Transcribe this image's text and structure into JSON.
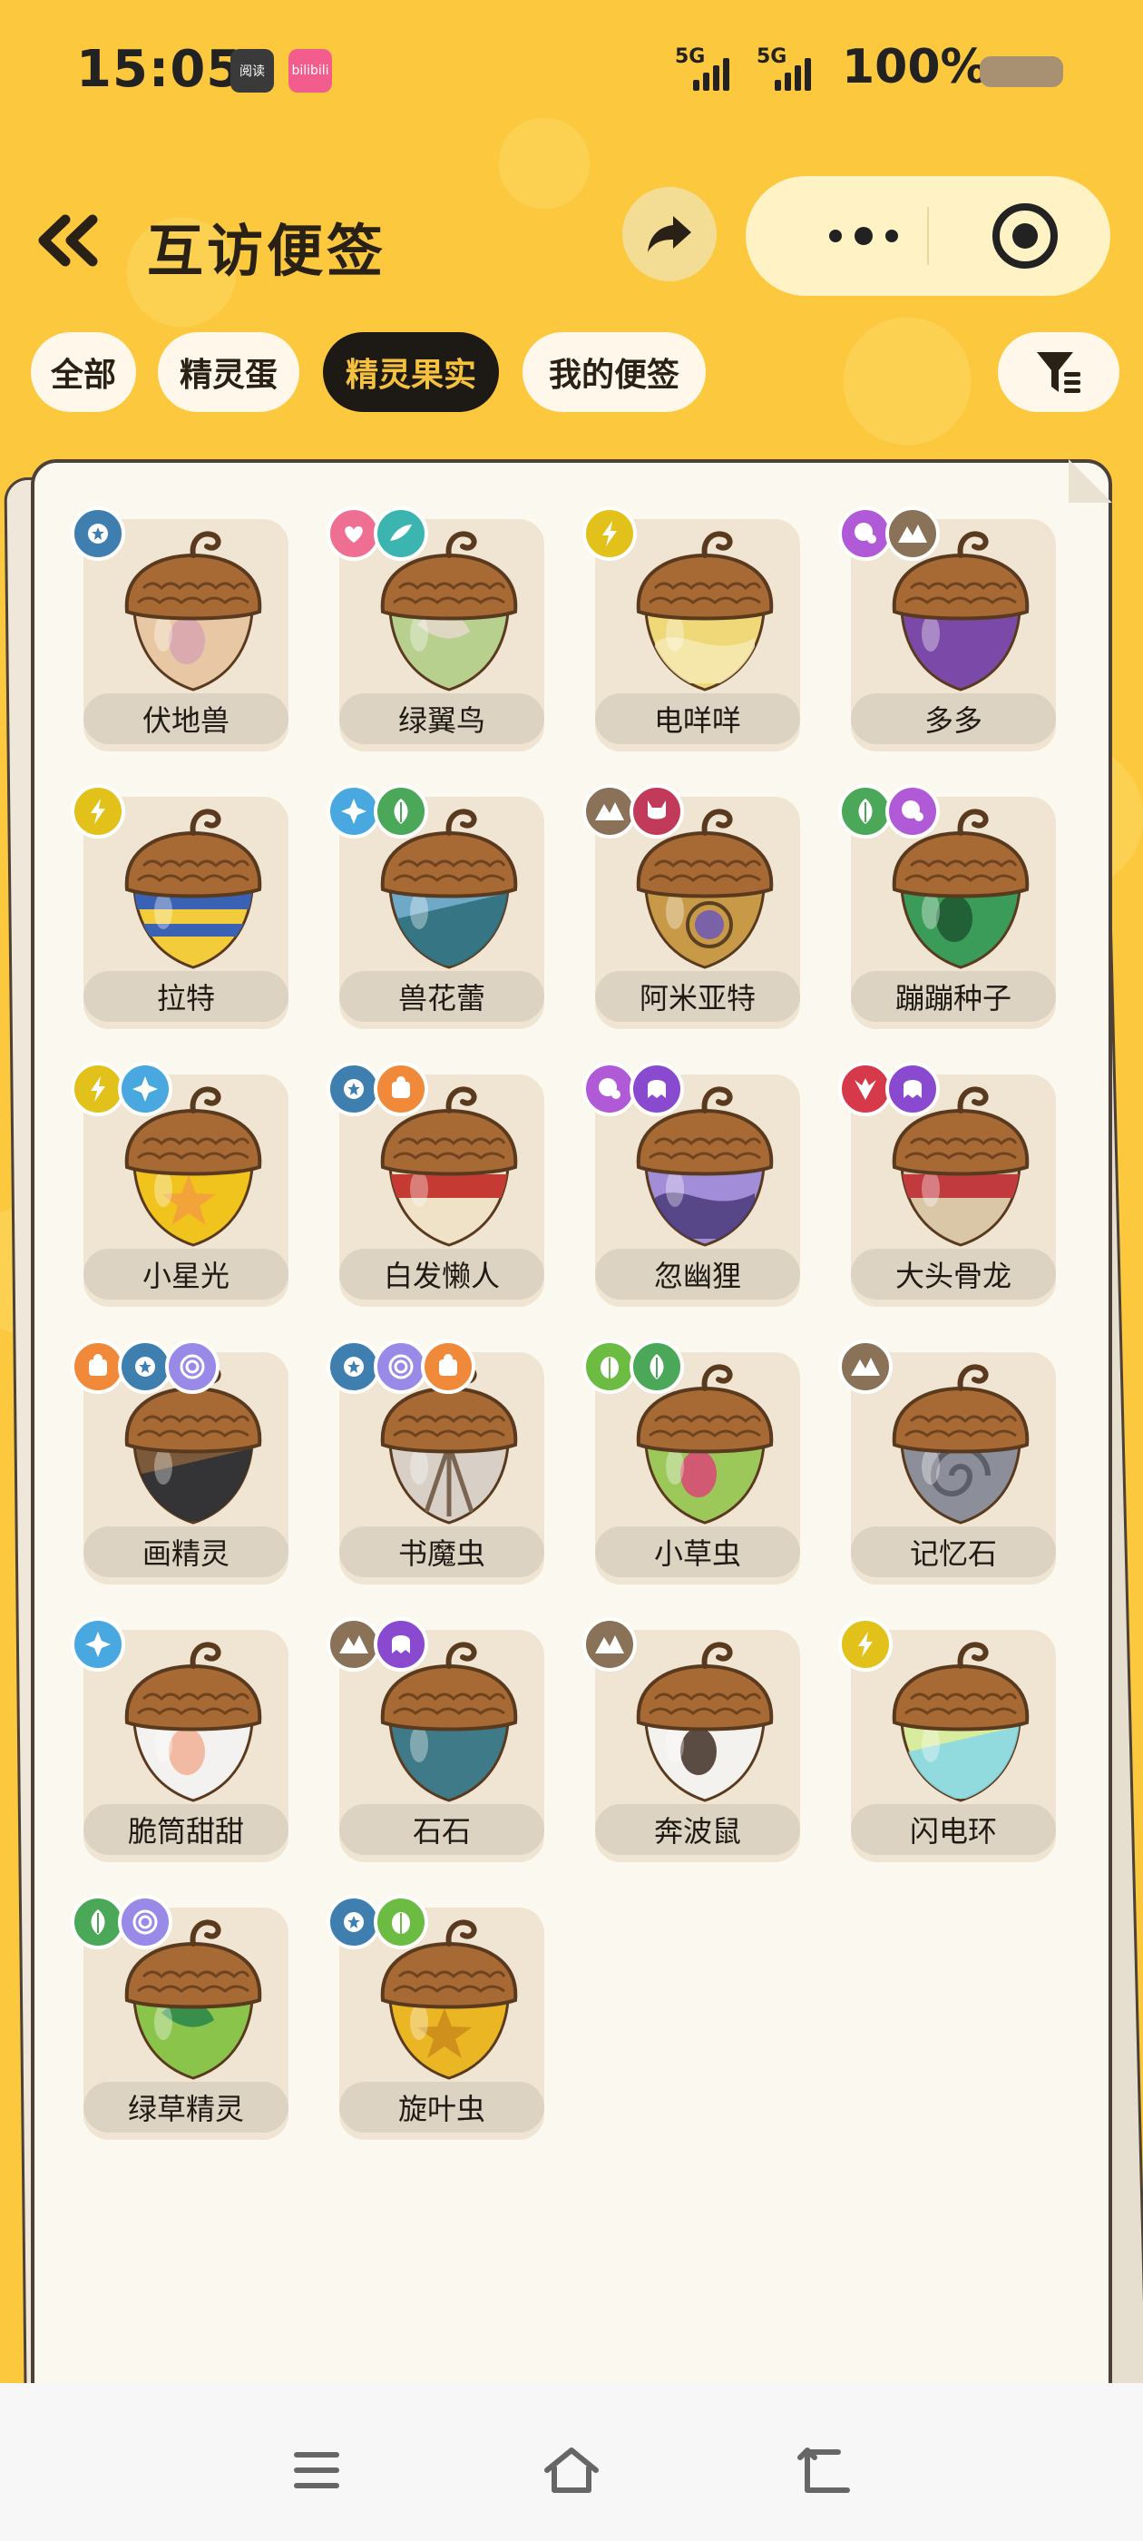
{
  "status_bar": {
    "time": "15:05",
    "apps": [
      {
        "name": "reader-app",
        "text": "阅读"
      },
      {
        "name": "bilibili-app",
        "text": "bilibili"
      }
    ],
    "signal_1": "5G",
    "signal_2": "5G",
    "battery": "100%"
  },
  "header": {
    "title": "互访便签",
    "icons": [
      "double-chevron-left-icon",
      "share-arrow-icon",
      "more-dots-icon",
      "target-icon"
    ]
  },
  "tabs": [
    {
      "label": "全部",
      "active": false
    },
    {
      "label": "精灵蛋",
      "active": false
    },
    {
      "label": "精灵果实",
      "active": true
    },
    {
      "label": "我的便签",
      "active": false
    }
  ],
  "filter_icon": "filter-icon",
  "colors": {
    "background": "#fbc83e",
    "active_tab_bg": "#1d1a16",
    "active_tab_text": "#f6c23d",
    "card_bg": "#fbf8ef"
  },
  "items": [
    {
      "name": "伏地兽",
      "types": [
        "normal"
      ],
      "body": "#e8c8a4",
      "accent": "#d9a6b0",
      "pattern": "spot"
    },
    {
      "name": "绿翼鸟",
      "types": [
        "cute",
        "wing"
      ],
      "body": "#b7d08e",
      "accent": "#e2d8c8",
      "pattern": "leaf"
    },
    {
      "name": "电咩咩",
      "types": [
        "electric"
      ],
      "body": "#eed878",
      "accent": "#f6e9b2",
      "pattern": "wave"
    },
    {
      "name": "多多",
      "types": [
        "ghost",
        "ground"
      ],
      "body": "#7b4aa8",
      "accent": "#5b3488",
      "pattern": "plain"
    },
    {
      "name": "拉特",
      "types": [
        "electric"
      ],
      "body": "#f2cc3a",
      "accent": "#3a62b4",
      "pattern": "stripes"
    },
    {
      "name": "兽花蕾",
      "types": [
        "ice",
        "grass"
      ],
      "body": "#6eaac8",
      "accent": "#2f6f7c",
      "pattern": "split"
    },
    {
      "name": "阿米亚特",
      "types": [
        "ground",
        "demon"
      ],
      "body": "#c89a48",
      "accent": "#7a62a8",
      "pattern": "gem"
    },
    {
      "name": "蹦蹦种子",
      "types": [
        "grass",
        "ghost"
      ],
      "body": "#3b9b58",
      "accent": "#1f5b32",
      "pattern": "spot"
    },
    {
      "name": "小星光",
      "types": [
        "electric",
        "ice"
      ],
      "body": "#f0c41c",
      "accent": "#f2a43a",
      "pattern": "star"
    },
    {
      "name": "白发懒人",
      "types": [
        "normal",
        "fire"
      ],
      "body": "#efe2c6",
      "accent": "#c63a34",
      "pattern": "band"
    },
    {
      "name": "忽幽狸",
      "types": [
        "ghost",
        "spirit"
      ],
      "body": "#a28ed8",
      "accent": "#4a3a7a",
      "pattern": "wave"
    },
    {
      "name": "大头骨龙",
      "types": [
        "dragon",
        "spirit"
      ],
      "body": "#d9c7a8",
      "accent": "#c03a3e",
      "pattern": "band"
    },
    {
      "name": "画精灵",
      "types": [
        "fire",
        "normal",
        "psychic"
      ],
      "body": "#7a5a3a",
      "accent": "#2c3036",
      "pattern": "split"
    },
    {
      "name": "书魔虫",
      "types": [
        "normal",
        "psychic",
        "fire"
      ],
      "body": "#d8d0c6",
      "accent": "#7a6452",
      "pattern": "shell"
    },
    {
      "name": "小草虫",
      "types": [
        "bug",
        "grass"
      ],
      "body": "#9cc85a",
      "accent": "#d84c74",
      "pattern": "spot"
    },
    {
      "name": "记忆石",
      "types": [
        "ground"
      ],
      "body": "#8c8e9a",
      "accent": "#5c5e6a",
      "pattern": "swirl"
    },
    {
      "name": "脆筒甜甜",
      "types": [
        "ice"
      ],
      "body": "#f4f2f0",
      "accent": "#f2b49a",
      "pattern": "spot"
    },
    {
      "name": "石石",
      "types": [
        "ground",
        "spirit"
      ],
      "body": "#3e7a88",
      "accent": "#8cd2d2",
      "pattern": "plain"
    },
    {
      "name": "奔波鼠",
      "types": [
        "ground"
      ],
      "body": "#f4f2ee",
      "accent": "#4a3a30",
      "pattern": "spot"
    },
    {
      "name": "闪电环",
      "types": [
        "electric"
      ],
      "body": "#d8ec9e",
      "accent": "#8ad8e4",
      "pattern": "split"
    },
    {
      "name": "绿草精灵",
      "types": [
        "grass",
        "psychic"
      ],
      "body": "#8ac44a",
      "accent": "#2f8a4a",
      "pattern": "leaf"
    },
    {
      "name": "旋叶虫",
      "types": [
        "normal",
        "bug"
      ],
      "body": "#eab624",
      "accent": "#d0901c",
      "pattern": "star"
    }
  ],
  "type_colors": {
    "normal": "#3e7fb0",
    "cute": "#ee6f92",
    "wing": "#3cb5b0",
    "electric": "#e2c21a",
    "ghost": "#b05ad8",
    "ground": "#8a7258",
    "ice": "#4aa8e0",
    "grass": "#4aa858",
    "demon": "#c23a5a",
    "fire": "#f08a3a",
    "spirit": "#8a4ad0",
    "dragon": "#d63a4a",
    "psychic": "#9a8ae8",
    "bug": "#6cbc44"
  },
  "bottom_nav": [
    "menu-icon",
    "home-icon",
    "back-icon"
  ]
}
